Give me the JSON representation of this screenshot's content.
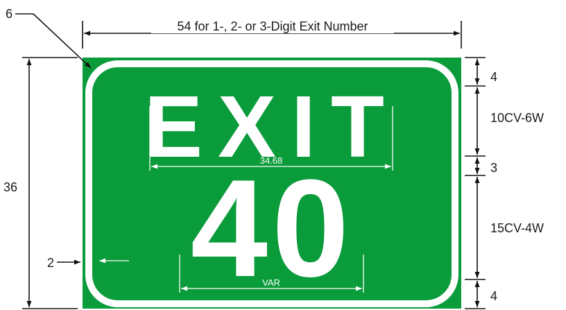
{
  "sign": {
    "background_color": "#0a9b3a",
    "legend_color": "#ffffff",
    "legend_word": "EXIT",
    "exit_number": "40"
  },
  "dimensions": {
    "overall_width": "54 for 1-, 2- or 3-Digit Exit Number",
    "overall_height": "36",
    "corner_radius": "6",
    "border_offset": "2",
    "top_margin": "4",
    "word_height": "10CV-6W",
    "line_gap": "3",
    "number_height": "15CV-4W",
    "bottom_margin": "4",
    "word_width": "34.68",
    "number_width": "VAR"
  }
}
